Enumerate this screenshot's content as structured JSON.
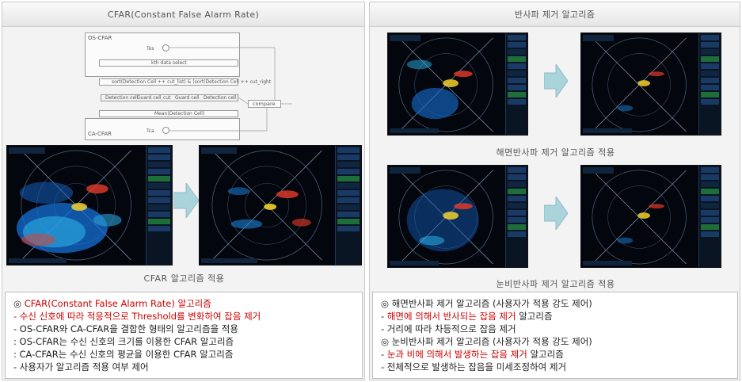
{
  "left": {
    "title": "CFAR(Constant False Alarm Rate)",
    "diagram": {
      "os_label": "OS-CFAR",
      "ca_label": "CA-CFAR",
      "tos": "Tos",
      "tca": "Tca",
      "kth": "kth data select",
      "sort": "sort(Detection Cell ++ cut_list) & (sort(Detection Cell ++ cut_right",
      "detection": "Detection cell",
      "guard": "Guard cell",
      "cut": "cut",
      "compare": "compare",
      "mean": "Mean(Detection Cell)"
    },
    "caption": "CFAR 알고리즘 적용",
    "text": {
      "l1_prefix": "◎ ",
      "l1": "CFAR(Constant False Alarm Rate) 알고리즘",
      "l2": " - 수신 신호에 따라 적응적으로 Threshold를 변화하여 잡음 제거",
      "l3": " - OS-CFAR와 CA-CFAR을 결합한 형태의 알고리즘을 적용",
      "l4": "   : OS-CFAR는 수신 신호의 크기를 이용한 CFAR 알고리즘",
      "l5": "   : CA-CFAR는 수신 신호의 평균을 이용한 CFAR 알고리즘",
      "l6": " - 사용자가 알고리즘 적용 여부 제어"
    }
  },
  "right": {
    "title": "반사파 제거 알고리즘",
    "caption1": "해면반사파 제거 알고리즘 적용",
    "caption2": "눈비반사파 제거 알고리즘 적용",
    "text": {
      "l1": "◎ 해면반사파 제거 알고리즘 (사용자가 적용 강도 제어)",
      "l2_prefix": " - ",
      "l2_red": "해면에 의해서 반사되는 잡음 제거",
      "l2_suffix": " 알고리즘",
      "l3": " - 거리에 따라 차등적으로 잡음 제거",
      "l4": "◎ 눈비반사파 제거 알고리즘 (사용자가 적용 강도 제어)",
      "l5_prefix": " - ",
      "l5_red": "눈과 비에 의해서 발생하는 잡음 제거",
      "l5_suffix": " 알고리즘",
      "l6": " - 전체적으로 발생하는 잡음을 미세조정하여 제거"
    }
  },
  "colors": {
    "arrow": "#a9d4dc",
    "radar_bg": "#03060c",
    "accent_red": "#cc0000"
  }
}
